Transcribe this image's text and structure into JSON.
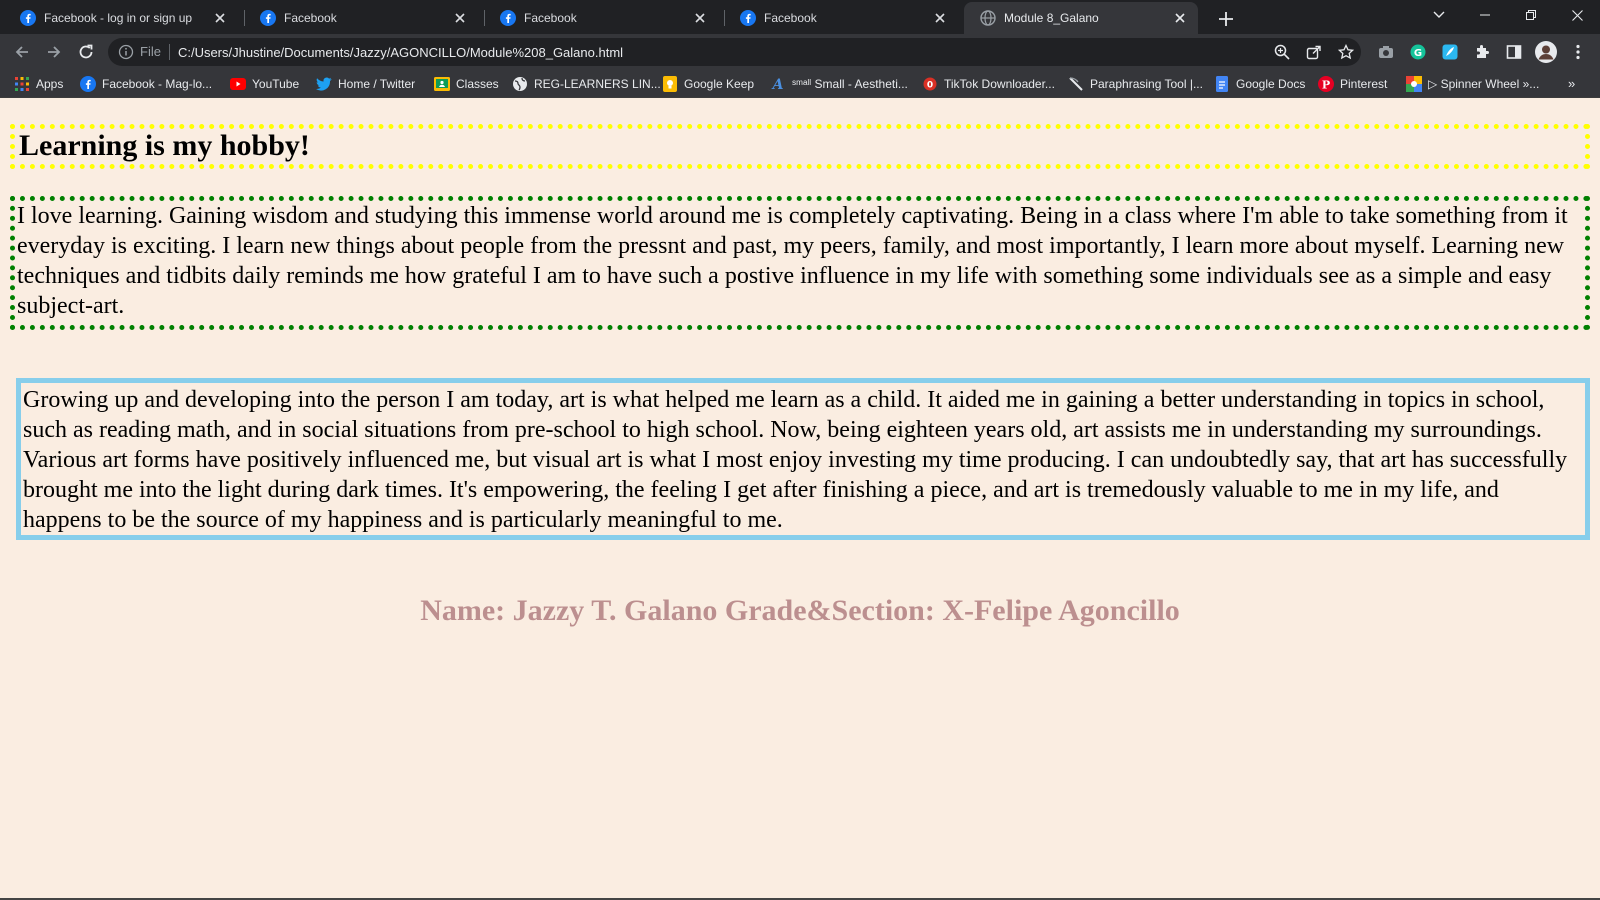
{
  "browser": {
    "tabs": [
      {
        "title": "Facebook - log in or sign up",
        "icon": "facebook-icon",
        "active": false
      },
      {
        "title": "Facebook",
        "icon": "facebook-icon",
        "active": false
      },
      {
        "title": "Facebook",
        "icon": "facebook-icon",
        "active": false
      },
      {
        "title": "Facebook",
        "icon": "facebook-icon",
        "active": false
      },
      {
        "title": "Module 8_Galano",
        "icon": "globe-icon",
        "active": true
      }
    ],
    "address": {
      "scheme": "File",
      "url": "C:/Users/Jhustine/Documents/Jazzy/AGONCILLO/Module%208_Galano.html"
    },
    "bookmarks": [
      {
        "label": "Apps",
        "icon": "apps-grid-icon"
      },
      {
        "label": "Facebook - Mag-lo...",
        "icon": "facebook-icon"
      },
      {
        "label": "YouTube",
        "icon": "youtube-icon"
      },
      {
        "label": "Home / Twitter",
        "icon": "twitter-icon"
      },
      {
        "label": "Classes",
        "icon": "classroom-icon"
      },
      {
        "label": "REG-LEARNERS LIN...",
        "icon": "globe-icon"
      },
      {
        "label": "Google Keep",
        "icon": "keep-icon"
      },
      {
        "label": "ˢᵐᵃˡˡ Small - Aestheti...",
        "icon": "font-a-icon"
      },
      {
        "label": "TikTok Downloader...",
        "icon": "tiktok-icon"
      },
      {
        "label": "Paraphrasing Tool |...",
        "icon": "quill-icon"
      },
      {
        "label": "Google Docs",
        "icon": "docs-icon"
      },
      {
        "label": "Pinterest",
        "icon": "pinterest-icon"
      },
      {
        "label": "▷ Spinner Wheel »...",
        "icon": "spinner-icon"
      }
    ],
    "more_bookmarks": "»",
    "colors": {
      "tab_bg": "#202124",
      "toolbar_bg": "#35363a",
      "page_bg": "#faede1"
    }
  },
  "page": {
    "heading": "Learning is my hobby!",
    "paragraph1": "I love learning. Gaining wisdom and studying this immense world around me is completely captivating. Being in a class where I'm able to take something from it everyday is exciting. I learn new things about people from the pressnt and past, my peers, family, and most importantly, I learn more about myself. Learning new techniques and tidbits daily reminds me how grateful I am to have such a postive influence in my life with something some individuals see as a simple and easy subject-art.",
    "paragraph2": "Growing up and developing into the person I am today, art is what helped me learn as a child. It aided me in gaining a better understanding in topics in school, such as reading math, and in social situations from pre-school to high school. Now, being eighteen years old, art assists me in understanding my surroundings. Various art forms have positively influenced me, but visual art is what I most enjoy investing my time producing. I can undoubtedly say, that art has successfully brought me into the light during dark times. It's empowering, the feeling I get after finishing a piece, and art is tremedously valuable to me in my life, and happens to be the source of my happiness and is particularly meaningful to me.",
    "footer": "Name: Jazzy T. Galano Grade&Section: X-Felipe Agoncillo",
    "colors": {
      "heading_border": "#ffff00",
      "para1_border": "#008000",
      "para2_border": "#87ceeb",
      "footer_text": "#bc8f8f"
    }
  }
}
